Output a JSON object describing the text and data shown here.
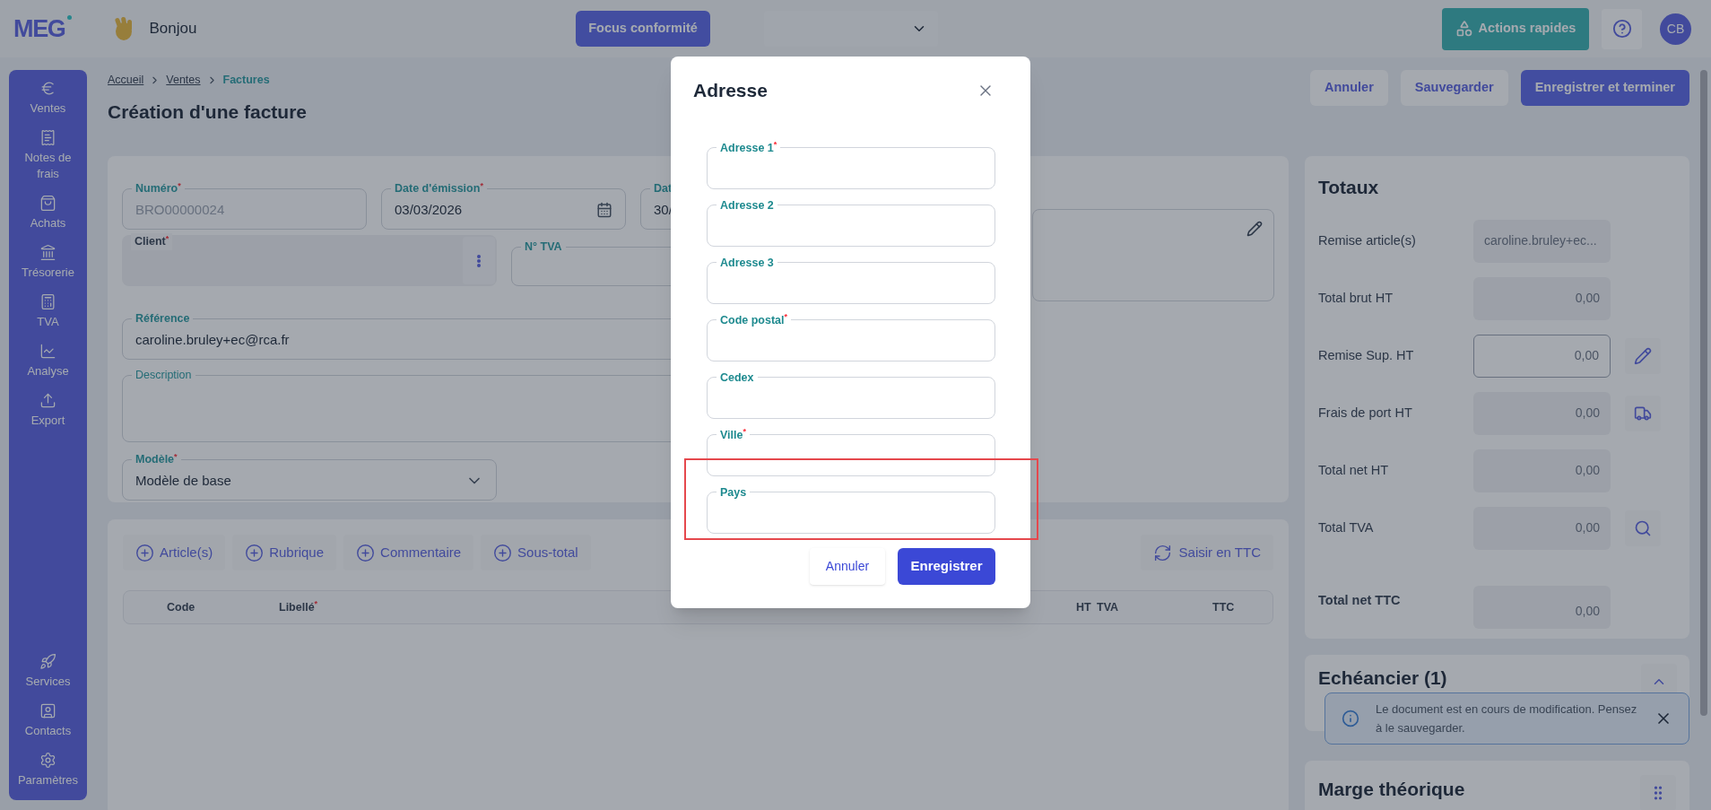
{
  "top_bar": {
    "logo": "MEG",
    "greeting": "Bonjou",
    "focus_button": "Focus conformité",
    "quick_actions": "Actions rapides",
    "avatar": "CB"
  },
  "sidebar": {
    "items": [
      {
        "label": "Ventes"
      },
      {
        "label": "Notes de frais"
      },
      {
        "label": "Achats"
      },
      {
        "label": "Trésorerie"
      },
      {
        "label": "TVA"
      },
      {
        "label": "Analyse"
      },
      {
        "label": "Export"
      }
    ],
    "bottom_items": [
      {
        "label": "Services"
      },
      {
        "label": "Contacts"
      },
      {
        "label": "Paramètres"
      }
    ]
  },
  "breadcrumb": [
    {
      "label": "Accueil",
      "kind": "link"
    },
    {
      "label": "Ventes",
      "kind": "link"
    },
    {
      "label": "Factures",
      "kind": "current"
    }
  ],
  "page_title": "Création d'une facture",
  "header_actions": [
    {
      "label": "Annuler",
      "kind": "secondary"
    },
    {
      "label": "Sauvegarder",
      "kind": "secondary"
    },
    {
      "label": "Enregistrer et terminer",
      "kind": "primary"
    }
  ],
  "form": {
    "fields": [
      {
        "kind": "number",
        "label": "Numéro$^{*}$",
        "value": "BRO00000024",
        "disabled": true
      },
      {
        "kind": "date",
        "label": "Date d'émission$^{*}$",
        "value": "03/03/2026"
      },
      {
        "kind": "date_cut",
        "label": "Dat",
        "value": "30/"
      },
      {
        "kind": "address"
      },
      {
        "kind": "client",
        "label": "Client$^{*}$",
        "disabled": true
      },
      {
        "kind": "vat",
        "label": "N° TVA"
      },
      {
        "kind": "reference",
        "label": "Référence",
        "value": "caroline.bruley+ec@rca.fr"
      },
      {
        "kind": "description",
        "label": "Description"
      },
      {
        "kind": "select",
        "label": "Modèle$^{*}$",
        "value": "Modèle de base"
      }
    ]
  },
  "items": {
    "add_buttons": [
      "Article(s)",
      "Rubrique",
      "Commentaire",
      "Sous-total"
    ],
    "ttc_button": "Saisir en TTC",
    "columns": [
      "Code",
      "Libellé$^{*}$",
      "HT",
      "TVA",
      "TTC"
    ]
  },
  "totals": {
    "title": "Totaux",
    "rows": [
      {
        "label": "Remise article(s)",
        "value": "caroline.bruley+ec...",
        "kind": "text"
      },
      {
        "label": "Total brut HT",
        "value": "0,00",
        "kind": "amount"
      },
      {
        "label": "Remise Sup. HT",
        "value": "0,00",
        "kind": "input"
      },
      {
        "label": "Frais de port HT",
        "value": "0,00",
        "kind": "amount"
      },
      {
        "label": "Total net HT",
        "value": "0,00",
        "kind": "amount"
      },
      {
        "label": "Total TVA",
        "value": "0,00",
        "kind": "amount"
      },
      {
        "label": "Total net TTC",
        "value": "0,00",
        "kind": "total"
      }
    ]
  },
  "schedule": {
    "title": "Echéancier (1)"
  },
  "margin": {
    "title": "Marge théorique"
  },
  "toast": {
    "message": "Le document est en cours de modification. Pensez à le sauvegarder."
  },
  "modal": {
    "title": "Adresse",
    "fields": [
      {
        "label": "Adresse 1$^{*}$",
        "highlighted": false
      },
      {
        "label": "Adresse 2",
        "highlighted": false
      },
      {
        "label": "Adresse 3",
        "highlighted": false
      },
      {
        "label": "Code postal$^{*}$",
        "highlighted": false
      },
      {
        "label": "Cedex",
        "highlighted": false
      },
      {
        "label": "Ville$^{*}$",
        "highlighted": false
      },
      {
        "label": "Pays",
        "highlighted": true
      }
    ],
    "cancel": "Annuler",
    "save": "Enregistrer"
  }
}
